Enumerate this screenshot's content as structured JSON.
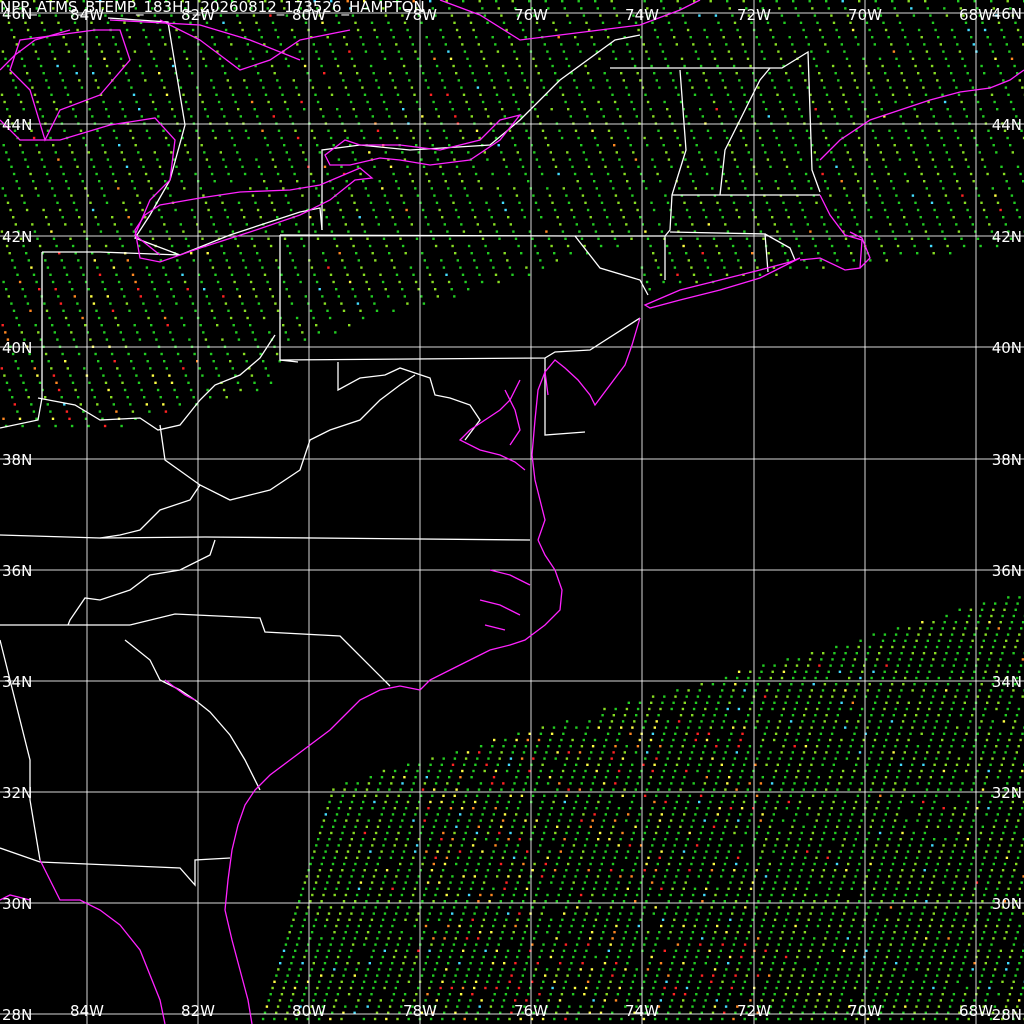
{
  "window": {
    "title": "NPP_ATMS_BTEMP_183H1_20260812_173526_HAMPTON"
  },
  "map": {
    "lon_labels": [
      "84W",
      "82W",
      "80W",
      "78W",
      "76W",
      "74W",
      "72W",
      "70W",
      "68W"
    ],
    "lat_labels": [
      "28N",
      "30N",
      "32N",
      "34N",
      "36N",
      "38N",
      "40N",
      "42N",
      "44N",
      "46N"
    ],
    "colors": {
      "background": "#000000",
      "grid": "#ffffff",
      "political_borders": "#ffffff",
      "coastline": "#ff22ff",
      "data_scale": [
        "#22cc22",
        "#88dd22",
        "#ffff44",
        "#ff8822",
        "#ff2222",
        "#44ddff"
      ]
    },
    "swaths": [
      {
        "name": "north-swath",
        "dominant_color": "#22cc22"
      },
      {
        "name": "south-swath",
        "dominant_color": "#22cc22"
      }
    ]
  }
}
